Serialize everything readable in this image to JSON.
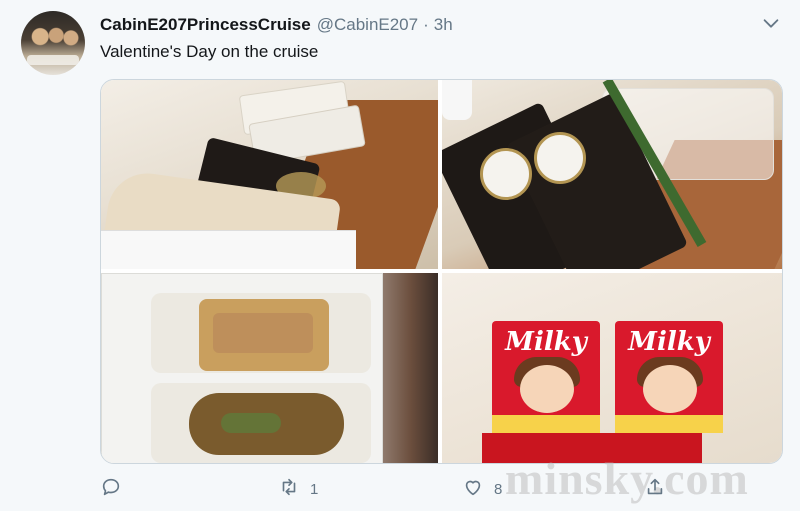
{
  "tweet": {
    "display_name": "CabinE207PrincessCruise",
    "handle": "@CabinE207",
    "separator": "·",
    "time": "3h",
    "text": "Valentine's Day on the cruise",
    "avatar_icon": "user-avatar"
  },
  "media": {
    "photos": [
      {
        "label": "photo-desk-boxes"
      },
      {
        "label": "photo-chocolate-packages"
      },
      {
        "label": "photo-food-container"
      },
      {
        "label": "photo-milky-candy"
      }
    ],
    "candy_box_text": "Milky"
  },
  "actions": {
    "reply_count": "",
    "retweet_count": "1",
    "like_count": "8",
    "icons": [
      "reply-icon",
      "retweet-icon",
      "like-icon",
      "share-icon"
    ]
  },
  "watermark": {
    "text": "minsky.com"
  },
  "colors": {
    "muted": "#657786",
    "text": "#14171a",
    "background": "#f5f8fa"
  }
}
